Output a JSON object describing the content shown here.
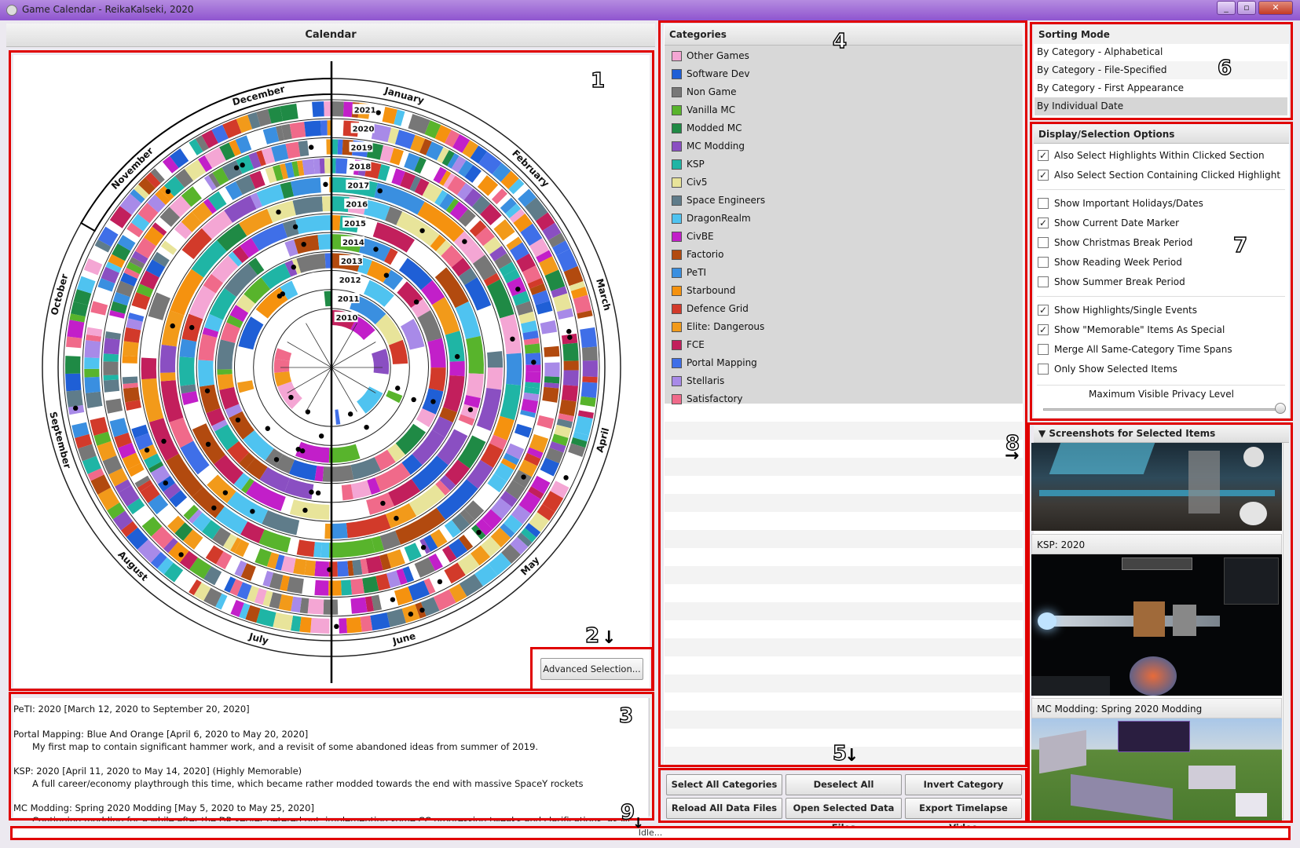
{
  "window": {
    "title": "Game Calendar - ReikaKalseki, 2020",
    "min": "_",
    "max": "▫",
    "close": "✕"
  },
  "calendar": {
    "header": "Calendar",
    "months": [
      "January",
      "February",
      "March",
      "April",
      "May",
      "June",
      "July",
      "August",
      "September",
      "October",
      "November",
      "December"
    ],
    "years": [
      "2021",
      "2020",
      "2019",
      "2018",
      "2017",
      "2016",
      "2015",
      "2014",
      "2013",
      "2012",
      "2011",
      "2010"
    ],
    "advanced_button": "Advanced Selection..."
  },
  "log": {
    "lines": [
      {
        "text": "PeTI: 2020 [March 12, 2020 to September 20, 2020]",
        "indent": false
      },
      {
        "text": "Portal Mapping: Blue And Orange [April 6, 2020 to May 20, 2020]",
        "indent": false
      },
      {
        "text": "My first map to contain significant hammer work, and a revisit of some abandoned ideas from summer of 2019.",
        "indent": true
      },
      {
        "text": "KSP: 2020 [April 11, 2020 to May 14, 2020] (Highly Memorable)",
        "indent": false
      },
      {
        "text": "A full career/economy playthrough this time, which became rather modded towards the end with massive SpaceY rockets",
        "indent": true
      },
      {
        "text": "MC Modding: Spring 2020 Modding [May 5, 2020 to May 25, 2020]",
        "indent": false
      },
      {
        "text": "Continuing modding for a while after the DR server petered out; implementing some CC progression tweaks and clarifications, as well as the new Tungsten",
        "indent": true
      }
    ]
  },
  "categories": {
    "header": "Categories",
    "items": [
      {
        "label": "Other Games",
        "color": "#f4a6d4"
      },
      {
        "label": "Software Dev",
        "color": "#1f5fd6"
      },
      {
        "label": "Non Game",
        "color": "#777777"
      },
      {
        "label": "Vanilla MC",
        "color": "#58b42c"
      },
      {
        "label": "Modded MC",
        "color": "#1f8a45"
      },
      {
        "label": "MC Modding",
        "color": "#8a4fc2"
      },
      {
        "label": "KSP",
        "color": "#1fb5a5"
      },
      {
        "label": "Civ5",
        "color": "#e8e49a"
      },
      {
        "label": "Space Engineers",
        "color": "#5f7c8a"
      },
      {
        "label": "DragonRealm",
        "color": "#4fc3f0"
      },
      {
        "label": "CivBE",
        "color": "#c21fc9"
      },
      {
        "label": "Factorio",
        "color": "#b24a0f"
      },
      {
        "label": "PeTI",
        "color": "#3a8fe0"
      },
      {
        "label": "Starbound",
        "color": "#f5920f"
      },
      {
        "label": "Defence Grid",
        "color": "#d23a2a"
      },
      {
        "label": "Elite: Dangerous",
        "color": "#f29a1a"
      },
      {
        "label": "FCE",
        "color": "#c21f5c"
      },
      {
        "label": "Portal Mapping",
        "color": "#3f6fe8"
      },
      {
        "label": "Stellaris",
        "color": "#a88ae8"
      },
      {
        "label": "Satisfactory",
        "color": "#f06a8a"
      }
    ],
    "buttons": [
      "Select All Categories",
      "Deselect All Categories",
      "Invert Category Selection",
      "Reload All Data Files",
      "Open Selected Data Files",
      "Export Timelapse Video"
    ]
  },
  "sorting": {
    "header": "Sorting Mode",
    "items": [
      "By Category - Alphabetical",
      "By Category - File-Specified",
      "By Category - First Appearance",
      "By Individual Date"
    ],
    "selected": 3
  },
  "options": {
    "header": "Display/Selection Options",
    "items": [
      {
        "label": "Also Select Highlights Within Clicked Section",
        "checked": true
      },
      {
        "label": "Also Select Section Containing Clicked Highlight",
        "checked": true
      },
      {
        "label": "Show Important Holidays/Dates",
        "checked": false
      },
      {
        "label": "Show Current Date Marker",
        "checked": true
      },
      {
        "label": "Show Christmas Break Period",
        "checked": false
      },
      {
        "label": "Show Reading Week Period",
        "checked": false
      },
      {
        "label": "Show Summer Break Period",
        "checked": false
      },
      {
        "label": "Show Highlights/Single Events",
        "checked": true
      },
      {
        "label": "Show \"Memorable\" Items As Special",
        "checked": true
      },
      {
        "label": "Merge All Same-Category Time Spans",
        "checked": false
      },
      {
        "label": "Only Show Selected Items",
        "checked": false
      }
    ],
    "privacy_label": "Maximum Visible Privacy Level",
    "privacy_level": 1.0
  },
  "screenshots": {
    "header": "Screenshots for Selected Items",
    "captions": [
      "KSP: 2020",
      "MC Modding: Spring 2020 Modding"
    ]
  },
  "status": "Idle...",
  "annotations": [
    "1",
    "2",
    "3",
    "4",
    "5",
    "6",
    "7",
    "8",
    "9"
  ]
}
